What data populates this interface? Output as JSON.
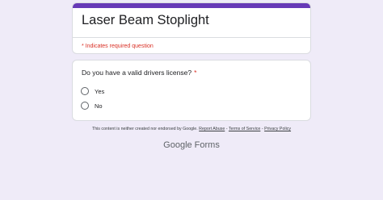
{
  "form": {
    "title": "Laser Beam Stoplight",
    "required_note": "* Indicates required question",
    "accent_color": "#673ab7"
  },
  "question": {
    "text": "Do you have a valid drivers license?",
    "required_marker": "*",
    "options": [
      {
        "label": "Yes",
        "selected": false
      },
      {
        "label": "No",
        "selected": false
      }
    ]
  },
  "footer": {
    "disclaimer": "This content is neither created nor endorsed by Google.",
    "links": [
      "Report Abuse",
      "Terms of Service",
      "Privacy Policy"
    ],
    "separator": " - ",
    "brand_google": "Google",
    "brand_forms": "Forms"
  }
}
